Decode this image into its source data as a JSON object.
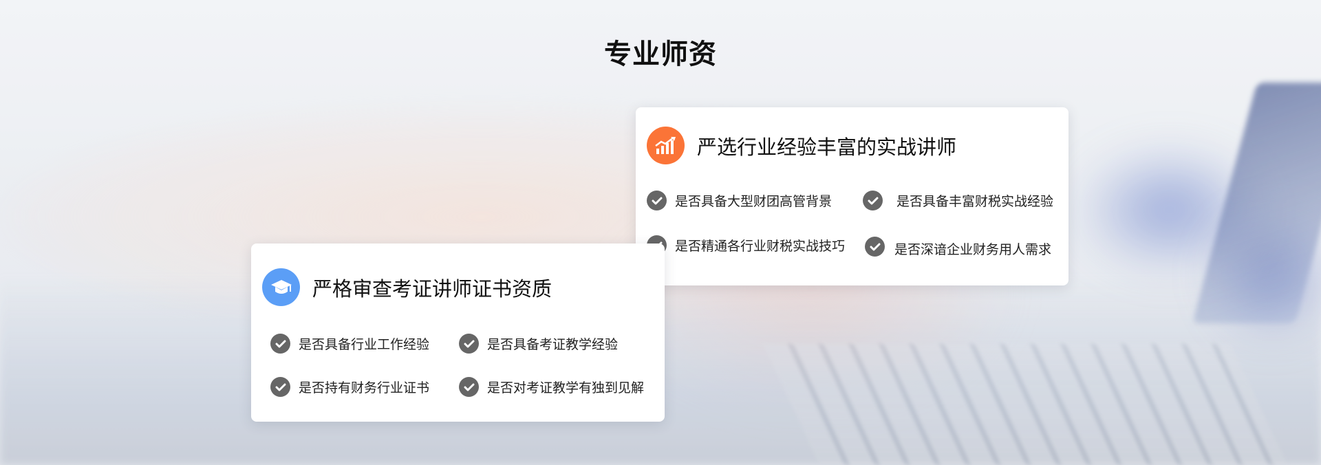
{
  "page": {
    "title": "专业师资"
  },
  "colors": {
    "orange_accent": "#fb7437",
    "blue_accent": "#5b9ef6",
    "check_gray": "#666666"
  },
  "cards": [
    {
      "icon": "growth-chart-icon",
      "title": "严选行业经验丰富的实战讲师",
      "items": [
        "是否具备大型财团高管背景",
        "是否具备丰富财税实战经验",
        "是否精通各行业财税实战技巧",
        "是否深谙企业财务用人需求"
      ]
    },
    {
      "icon": "graduation-cap-icon",
      "title": "严格审查考证讲师证书资质",
      "items": [
        "是否具备行业工作经验",
        "是否具备考证教学经验",
        "是否持有财务行业证书",
        "是否对考证教学有独到见解"
      ]
    }
  ]
}
